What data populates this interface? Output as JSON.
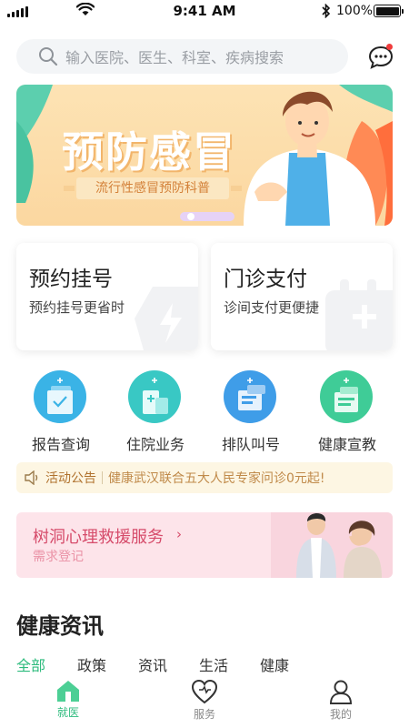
{
  "status_bar": {
    "time": "9:41 AM",
    "battery": "100%"
  },
  "search": {
    "placeholder": "输入医院、医生、科室、疾病搜索",
    "icon": "search-icon"
  },
  "header": {
    "message_icon": "chat-bubble-icon"
  },
  "banner": {
    "title": "预防感冒",
    "subtitle": "流行性感冒预防科普"
  },
  "cards": [
    {
      "title": "预约挂号",
      "subtitle": "预约挂号更省时",
      "icon": "lightning-icon"
    },
    {
      "title": "门诊支付",
      "subtitle": "诊间支付更便捷",
      "icon": "calendar-plus-icon"
    }
  ],
  "services": [
    {
      "label": "报告查询",
      "icon": "report-icon",
      "color": "#3ab3e6"
    },
    {
      "label": "住院业务",
      "icon": "hospital-icon",
      "color": "#39c8c4"
    },
    {
      "label": "排队叫号",
      "icon": "queue-icon",
      "color": "#3f9de8"
    },
    {
      "label": "健康宣教",
      "icon": "education-icon",
      "color": "#3fcc97"
    }
  ],
  "notice": {
    "label": "活动公告",
    "text": "健康武汉联合五大人民专家问诊0元起!"
  },
  "tree_hole": {
    "title": "树洞心理救援服务",
    "chevron": "›",
    "subtitle": "需求登记"
  },
  "news": {
    "title": "健康资讯",
    "tabs": [
      "全部",
      "政策",
      "资讯",
      "生活",
      "健康"
    ],
    "active_tab": "全部"
  },
  "bottom_nav": [
    {
      "label": "就医",
      "icon": "home-icon",
      "active": true
    },
    {
      "label": "服务",
      "icon": "heart-icon",
      "active": false
    },
    {
      "label": "我的",
      "icon": "user-icon",
      "active": false
    }
  ],
  "colors": {
    "accent": "#2dbb7d",
    "notice_text": "#c08a4a",
    "tree_title": "#d64c6b"
  }
}
